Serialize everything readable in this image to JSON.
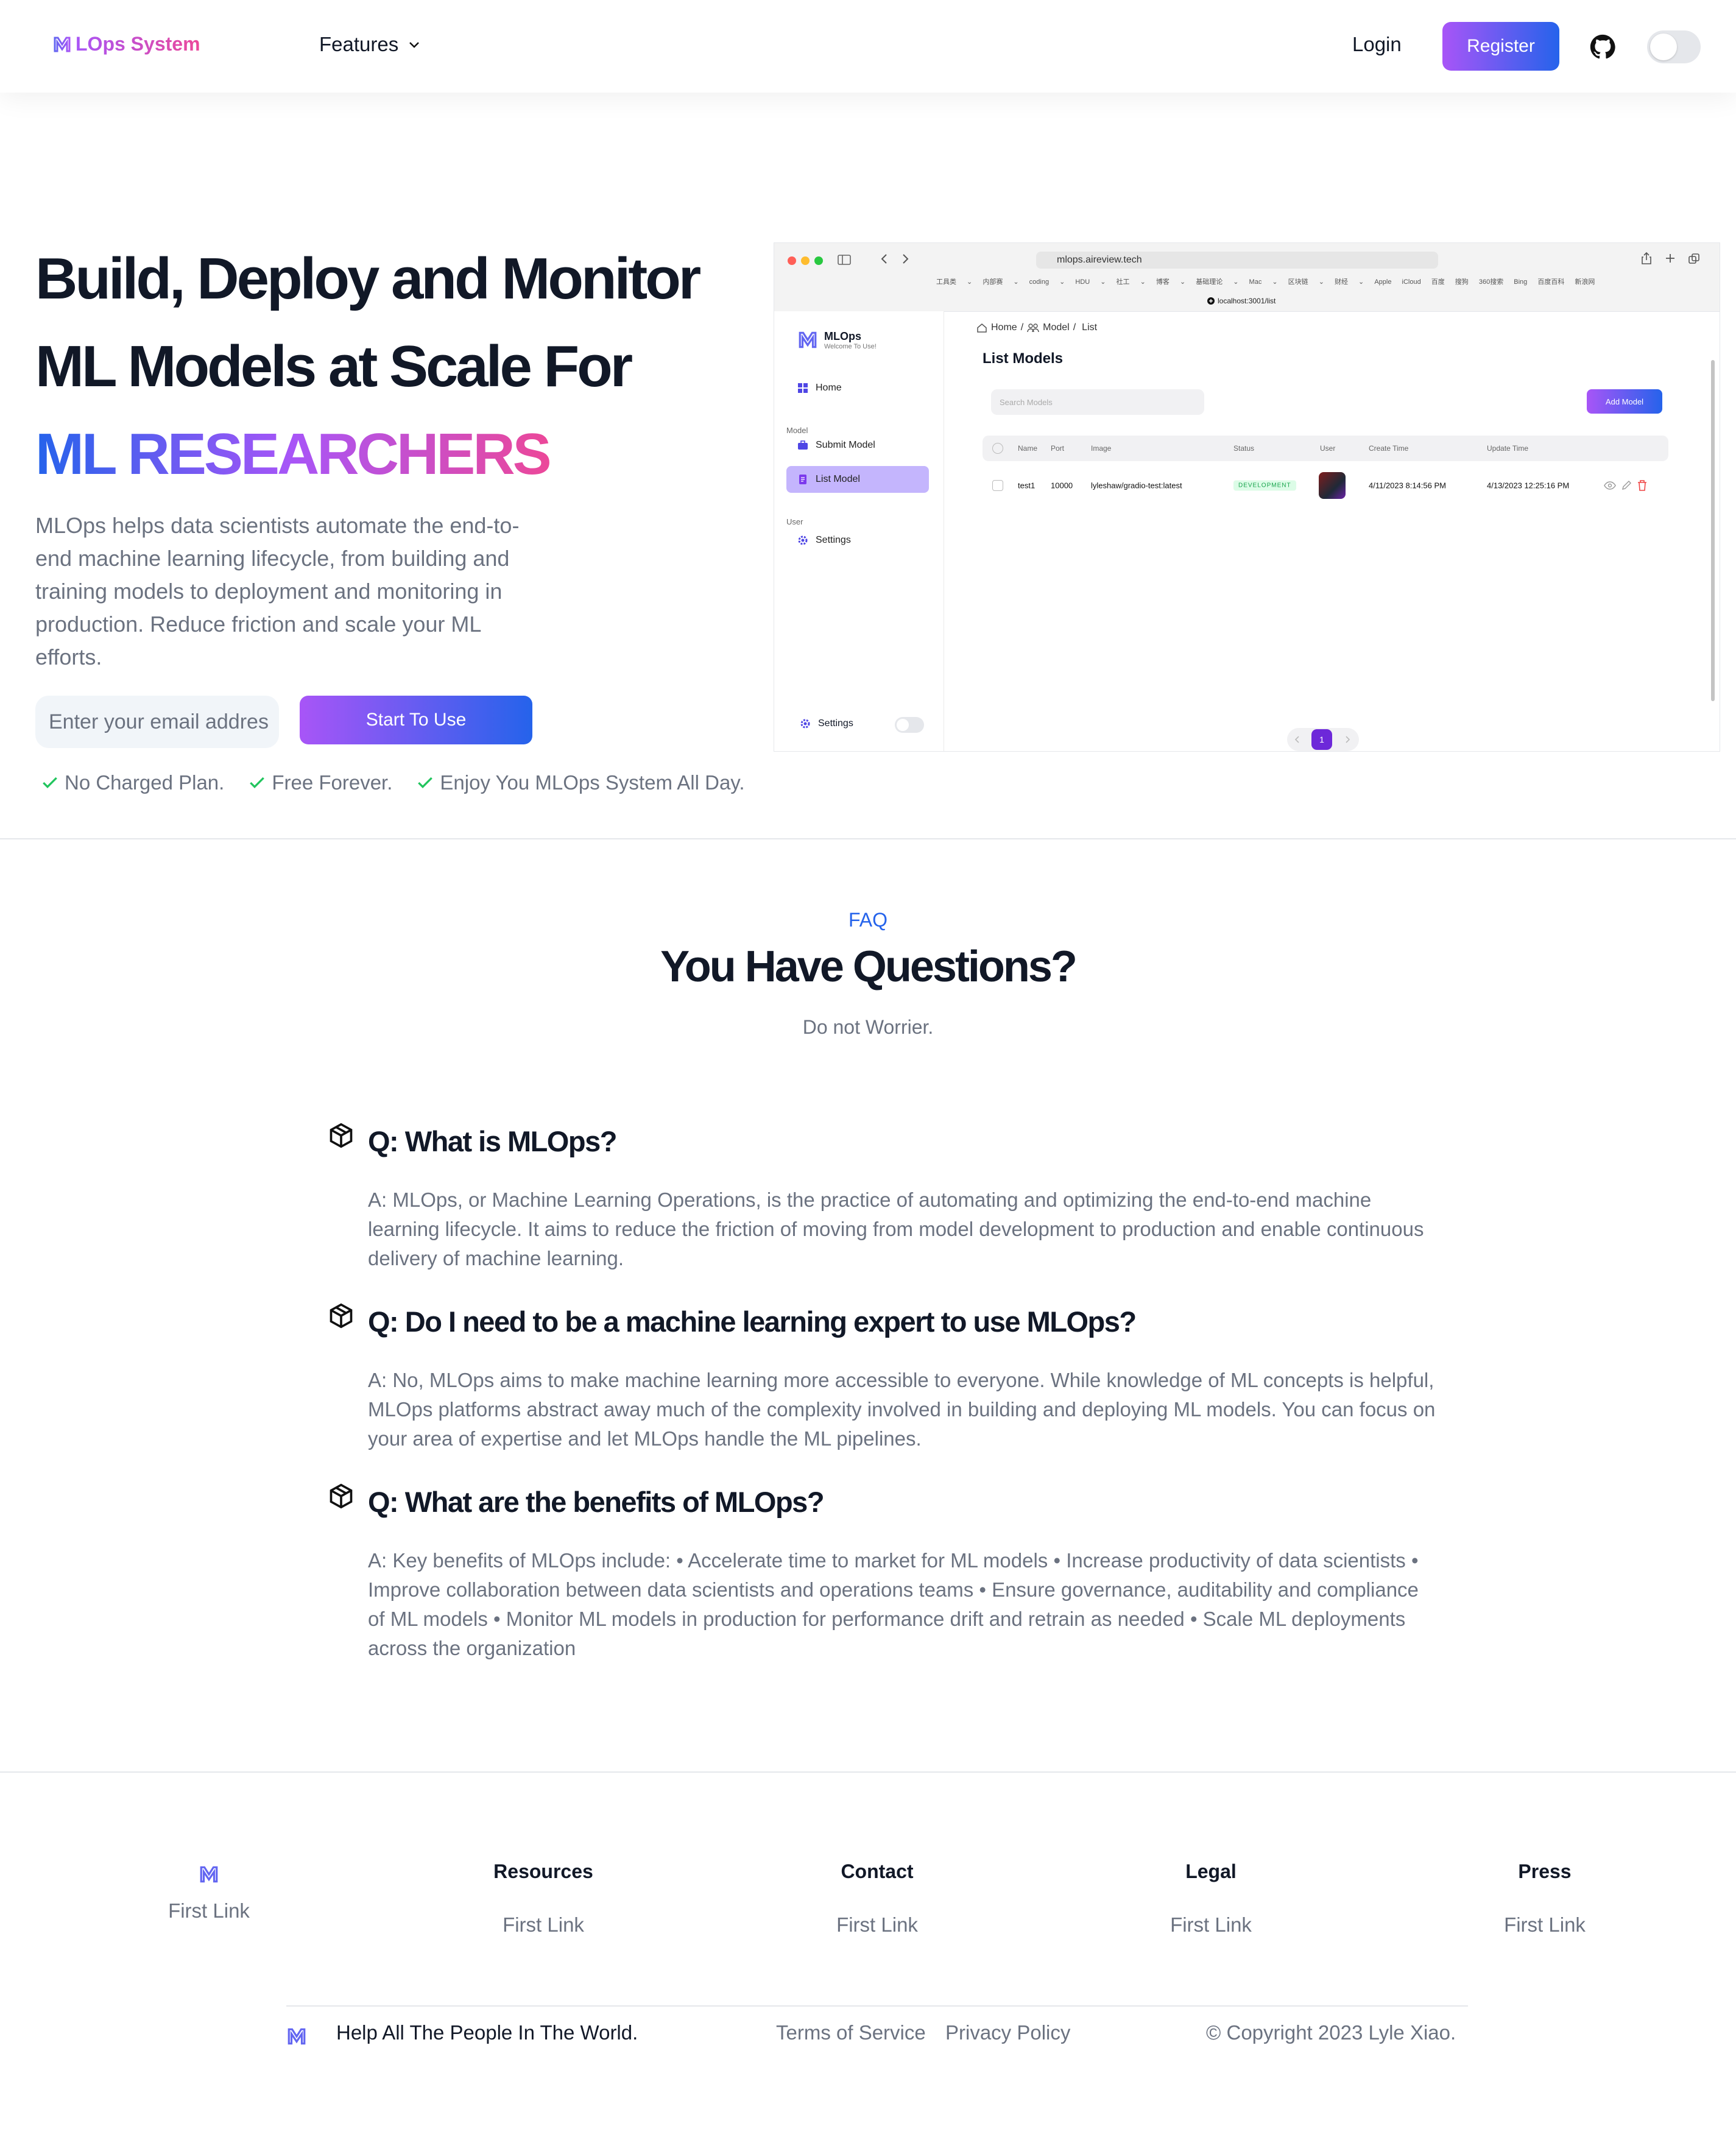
{
  "nav": {
    "brand": "LOps System",
    "features_label": "Features",
    "login_label": "Login",
    "register_label": "Register"
  },
  "hero": {
    "line1": "Build, Deploy and Monitor",
    "line2": "ML Models at Scale For",
    "line3": "ML RESEARCHERS",
    "description": "MLOps helps data scientists automate the end-to-end machine learning lifecycle, from building and training models to deployment and monitoring in production. Reduce friction and scale your ML efforts.",
    "email_placeholder": "Enter your email addres",
    "start_label": "Start To Use",
    "checks": [
      "No Charged Plan.",
      "Free Forever.",
      "Enjoy You MLOps System All Day."
    ]
  },
  "screenshot": {
    "url": "mlops.aireview.tech",
    "bookmarks": "工具类 ⌄ 内部赛 ⌄ coding ⌄ HDU ⌄ 社工 ⌄ 博客 ⌄ 基础理论 ⌄ Mac ⌄ 区块链 ⌄ 财经 ⌄ Apple iCloud 百度 搜狗 360搜索 Bing 百度百科 新浪网",
    "local_url": "localhost:3001/list",
    "app_name": "MLOps",
    "app_sub": "Welcome To Use!",
    "menu_home": "Home",
    "section_model": "Model",
    "menu_submit": "Submit Model",
    "menu_list": "List Model",
    "section_user": "User",
    "menu_settings": "Settings",
    "bottom_settings": "Settings",
    "breadcrumb_home": "Home",
    "breadcrumb_model": "Model",
    "breadcrumb_list": "List",
    "title": "List Models",
    "search_placeholder": "Search Models",
    "add_button": "Add Model",
    "table_headers": [
      "Name",
      "Port",
      "Image",
      "Status",
      "User",
      "Create Time",
      "Update Time"
    ],
    "row": {
      "name": "test1",
      "port": "10000",
      "image": "lyleshaw/gradio-test:latest",
      "status": "DEVELOPMENT",
      "create_time": "4/11/2023 8:14:56 PM",
      "update_time": "4/13/2023 12:25:16 PM"
    },
    "page_current": "1"
  },
  "faq": {
    "eyebrow": "FAQ",
    "title": "You Have Questions?",
    "subtitle": "Do not Worrier.",
    "items": [
      {
        "q": "Q: What is MLOps?",
        "a": "A: MLOps, or Machine Learning Operations, is the practice of automating and optimizing the end-to-end machine learning lifecycle. It aims to reduce the friction of moving from model development to production and enable continuous delivery of machine learning."
      },
      {
        "q": "Q: Do I need to be a machine learning expert to use MLOps?",
        "a": "A: No, MLOps aims to make machine learning more accessible to everyone. While knowledge of ML concepts is helpful, MLOps platforms abstract away much of the complexity involved in building and deploying ML models. You can focus on your area of expertise and let MLOps handle the ML pipelines."
      },
      {
        "q": "Q: What are the benefits of MLOps?",
        "a": "A: Key benefits of MLOps include: • Accelerate time to market for ML models • Increase productivity of data scientists • Improve collaboration between data scientists and operations teams • Ensure governance, auditability and compliance of ML models • Monitor ML models in production for performance drift and retrain as needed • Scale ML deployments across the organization"
      }
    ]
  },
  "footer": {
    "brand_link": "First Link",
    "columns": [
      {
        "title": "Resources",
        "link": "First Link"
      },
      {
        "title": "Contact",
        "link": "First Link"
      },
      {
        "title": "Legal",
        "link": "First Link"
      },
      {
        "title": "Press",
        "link": "First Link"
      }
    ],
    "tagline": "Help All The People In The World.",
    "terms": "Terms of Service",
    "privacy": "Privacy Policy",
    "copyright": "© Copyright 2023 Lyle Xiao."
  },
  "colors": {
    "accent_purple": "#a855f7",
    "accent_blue": "#2563eb",
    "accent_pink": "#ec4899",
    "text_muted": "#6b7280",
    "check_green": "#22c55e"
  }
}
